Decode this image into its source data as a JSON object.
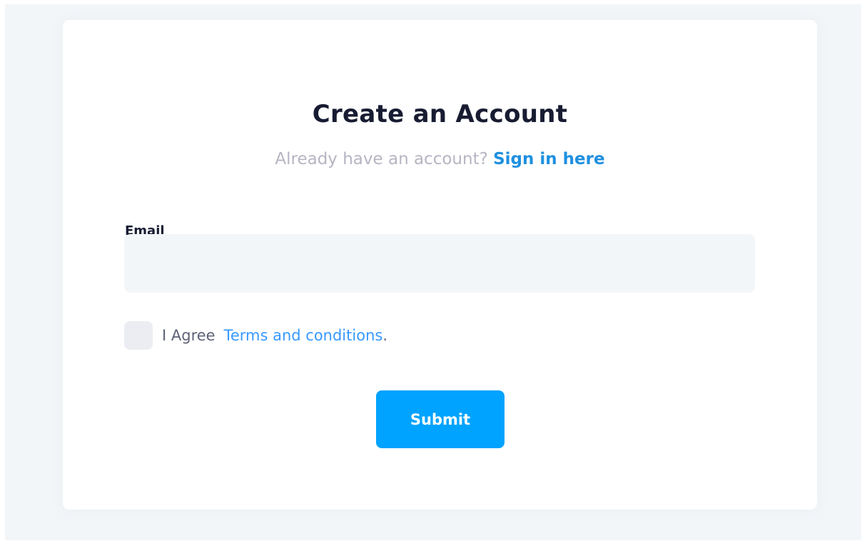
{
  "form": {
    "title": "Create an Account",
    "subtitle_text": "Already have an account?",
    "signin_link": "Sign in here",
    "email_label": "Email",
    "email_value": "",
    "agree_text": "I Agree",
    "terms_link": "Terms and conditions",
    "terms_period": ".",
    "submit_label": "Submit"
  },
  "colors": {
    "page_background": "#f3f6f9",
    "card_background": "#ffffff",
    "title": "#181c32",
    "muted_text": "#b5b5c3",
    "link": "#3699ff",
    "input_background": "#f3f6f9",
    "checkbox_background": "#ebedf3",
    "button": "#00a3ff"
  }
}
